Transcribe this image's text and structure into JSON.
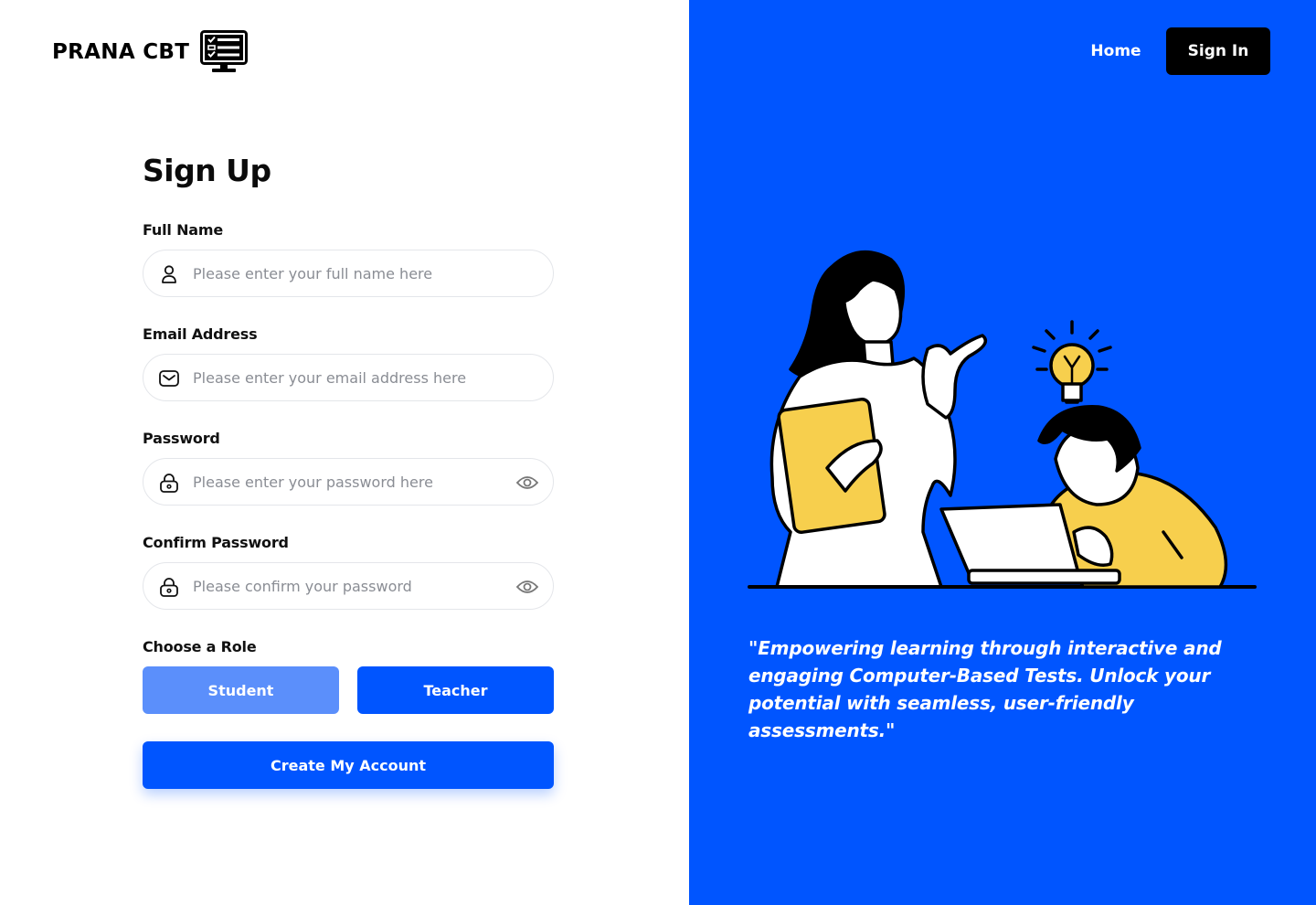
{
  "brand": {
    "name": "PRANA CBT",
    "icon": "computer-test-icon"
  },
  "nav": {
    "home_label": "Home",
    "signin_label": "Sign In"
  },
  "form": {
    "title": "Sign Up",
    "full_name": {
      "label": "Full Name",
      "placeholder": "Please enter your full name here",
      "icon": "user-icon"
    },
    "email": {
      "label": "Email Address",
      "placeholder": "Please enter your email address here",
      "icon": "mail-icon"
    },
    "password": {
      "label": "Password",
      "placeholder": "Please enter your password here",
      "icon": "lock-icon",
      "toggle_icon": "eye-icon"
    },
    "confirm_password": {
      "label": "Confirm Password",
      "placeholder": "Please confirm your password",
      "icon": "lock-icon",
      "toggle_icon": "eye-icon"
    },
    "role": {
      "label": "Choose a Role",
      "options": [
        "Student",
        "Teacher"
      ]
    },
    "submit_label": "Create My Account"
  },
  "hero": {
    "quote": "\"Empowering learning through interactive and engaging Computer-Based Tests. Unlock your potential with seamless, user-friendly assessments.\""
  },
  "colors": {
    "primary": "#0055ff",
    "student_button": "#5b8ffb",
    "sign_in_button": "#000000",
    "illustration_yellow": "#f7cf4d"
  }
}
